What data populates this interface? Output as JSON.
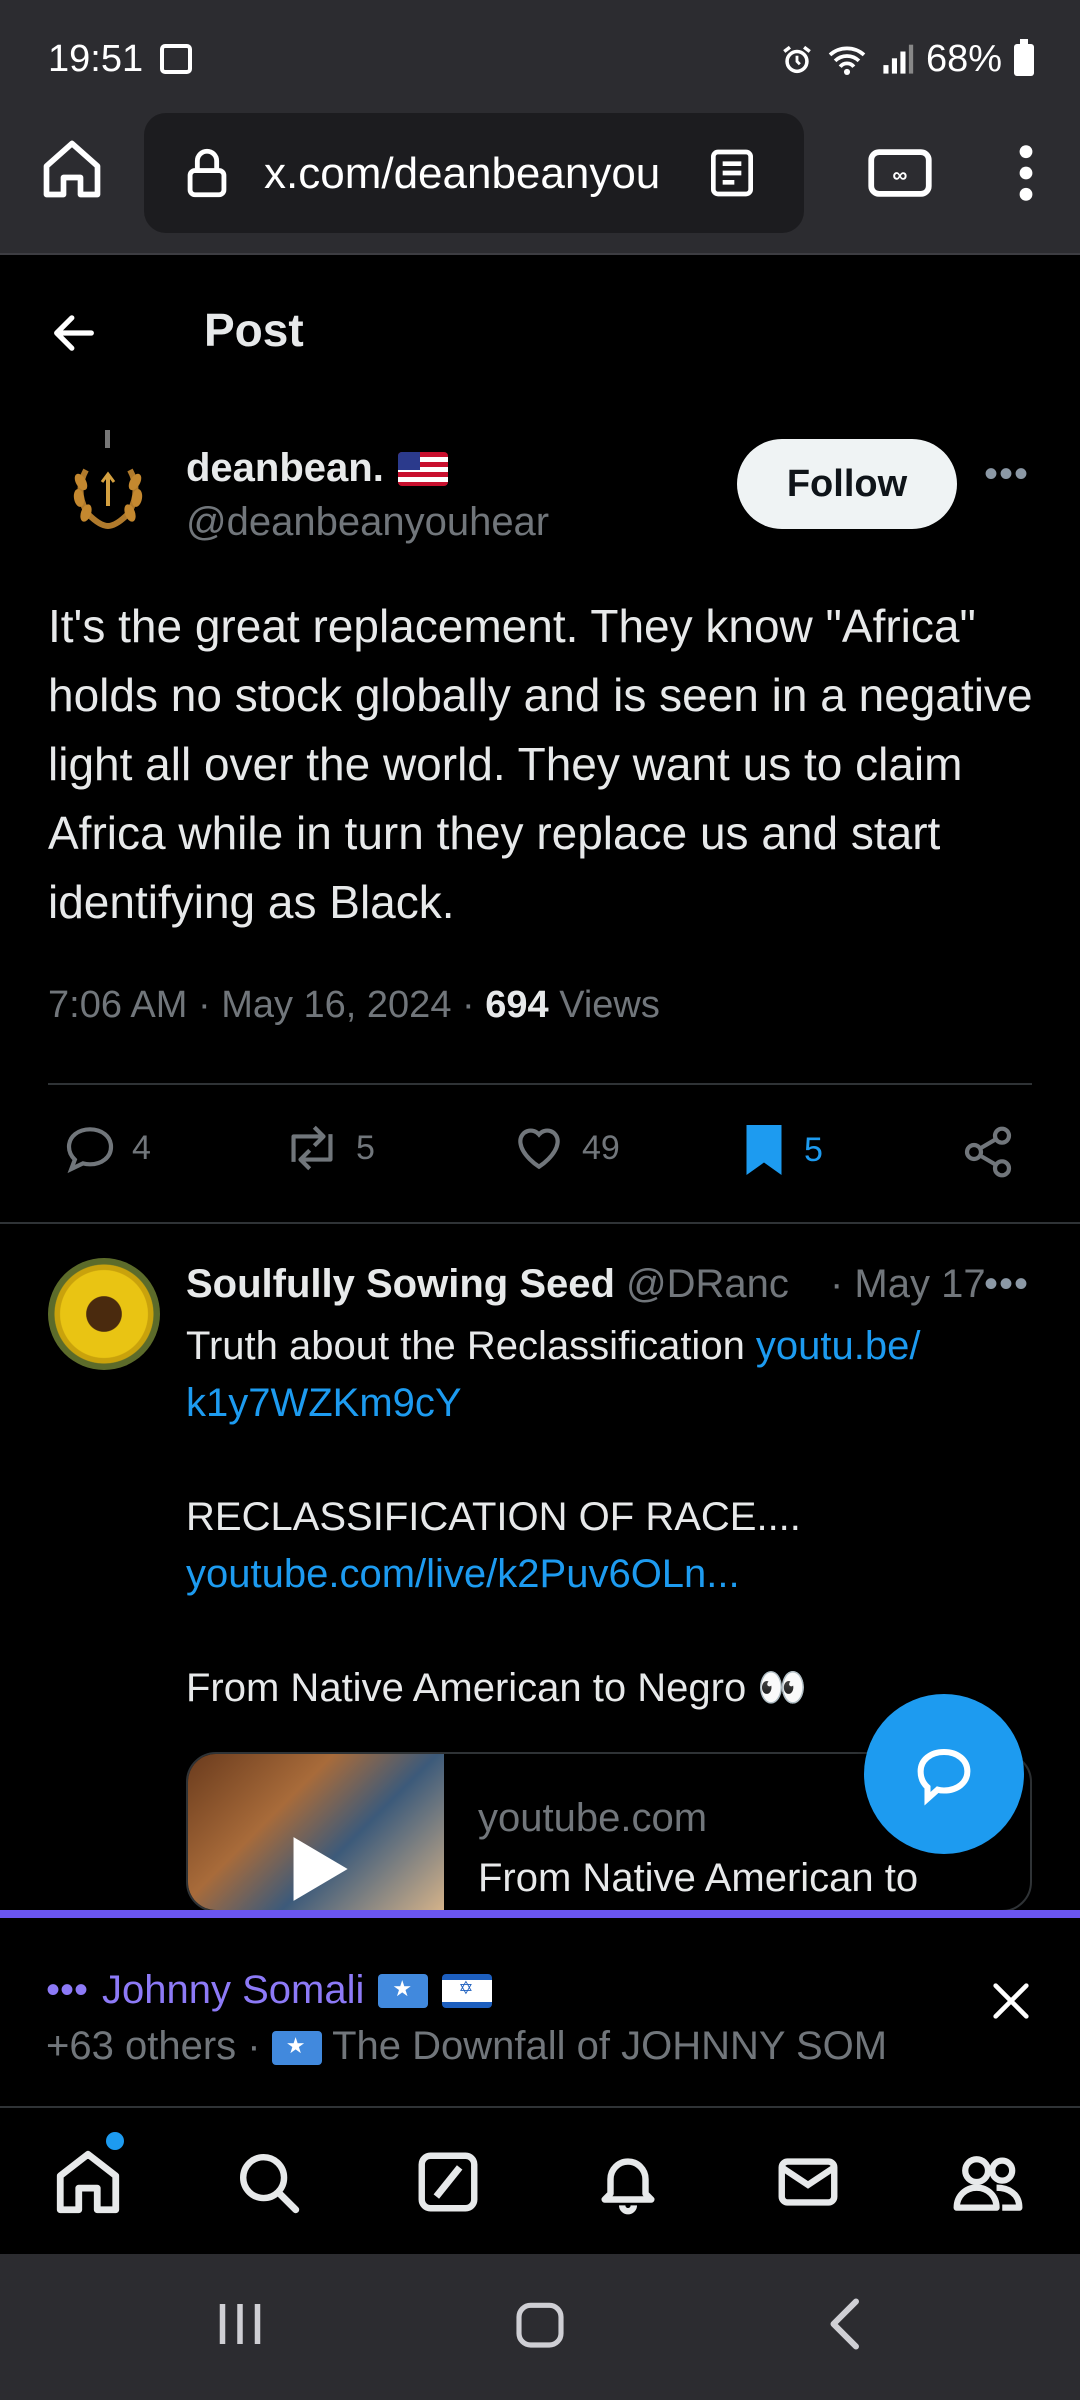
{
  "status_bar": {
    "time": "19:51",
    "battery": "68%"
  },
  "browser": {
    "url": "x.com/deanbeanyouhear/status/...",
    "url_visible": "x.com/deanbeanyou"
  },
  "header": {
    "title": "Post"
  },
  "post": {
    "author_name": "deanbean.",
    "author_handle": "@deanbeanyouhear",
    "follow_label": "Follow",
    "text": "It's the great replacement. They know \"Africa\" holds no stock globally and is seen in a negative light all over the world. They want us to claim Africa while in turn they replace us and start identifying as Black.",
    "time": "7:06 AM · May 16, 2024 · ",
    "views_count": "694",
    "views_label": " Views",
    "replies": "4",
    "reposts": "5",
    "likes": "49",
    "bookmarks": "5"
  },
  "reply": {
    "name": "Soulfully Sowing Seed",
    "handle": " @DRanc",
    "date": "· May 17",
    "line1": "Truth about the Reclassification ",
    "link1": "youtu.be/\nk1y7WZKm9cY",
    "line2": "RECLASSIFICATION OF RACE....",
    "link2": "youtube.com/live/k2Puv6OLn...",
    "line3": "From Native American to Negro 👀",
    "card_domain": "youtube.com",
    "card_title": "From Native American to"
  },
  "spaces": {
    "host": "Johnny Somali",
    "others": "+63 others · ",
    "title": "The Downfall of JOHNNY SOM"
  },
  "colors": {
    "accent": "#1d9bf0",
    "spaces_purple": "#8d7af7"
  }
}
